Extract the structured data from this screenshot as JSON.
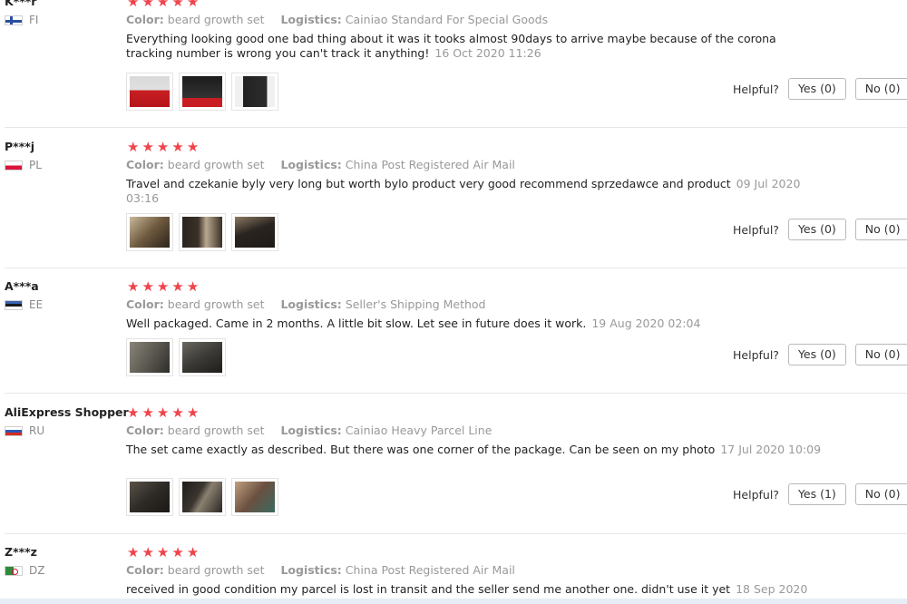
{
  "helpful_label": "Helpful?",
  "meta_labels": {
    "color": "Color:",
    "logistics": "Logistics:"
  },
  "star_glyph": "★",
  "reviews": [
    {
      "user": "K***r",
      "country": "FI",
      "flag": "finland",
      "rating": 5,
      "color": "beard growth set",
      "logistics": "Cainiao Standard For Special Goods",
      "text": "Everything looking good one bad thing about it was it tooks almost 90days to arrive maybe because of the corona tracking number is wrong you can't track it anything!",
      "date": "16 Oct 2020 11:26",
      "yes": "Yes (0)",
      "no": "No (0)",
      "photos": [
        "#c81e23",
        "#1b1b1b",
        "#222222"
      ]
    },
    {
      "user": "P***j",
      "country": "PL",
      "flag": "poland",
      "rating": 5,
      "color": "beard growth set",
      "logistics": "China Post Registered Air Mail",
      "text": "Travel and czekanie byly very long but worth bylo product very good recommend sprzedawce and product",
      "date": "09 Jul 2020 03:16",
      "yes": "Yes (0)",
      "no": "No (0)",
      "photos": [
        "#6e5a3e",
        "#3a3026",
        "#2a2420"
      ]
    },
    {
      "user": "A***a",
      "country": "EE",
      "flag": "estonia",
      "rating": 5,
      "color": "beard growth set",
      "logistics": "Seller's Shipping Method",
      "text": "Well packaged. Came in 2 months. A little bit slow. Let see in future does it work.",
      "date": "19 Aug 2020 02:04",
      "yes": "Yes (0)",
      "no": "No (0)",
      "photos": [
        "#5c5a52",
        "#3b3a36"
      ]
    },
    {
      "user": "AliExpress Shopper",
      "country": "RU",
      "flag": "russia",
      "rating": 5,
      "color": "beard growth set",
      "logistics": "Cainiao Heavy Parcel Line",
      "text": "The set came exactly as described. But there was one corner of the package. Can be seen on my photo",
      "date": "17 Jul 2020 10:09",
      "yes": "Yes (1)",
      "no": "No (0)",
      "photos": [
        "#2e2a26",
        "#3a3530",
        "#6a5040"
      ]
    },
    {
      "user": "Z***z",
      "country": "DZ",
      "flag": "algeria",
      "rating": 5,
      "color": "beard growth set",
      "logistics": "China Post Registered Air Mail",
      "text": "received in good condition my parcel is lost in transit and the seller send me another one. didn't use it yet",
      "date": "18 Sep 2020",
      "yes": "",
      "no": "",
      "photos": []
    }
  ]
}
